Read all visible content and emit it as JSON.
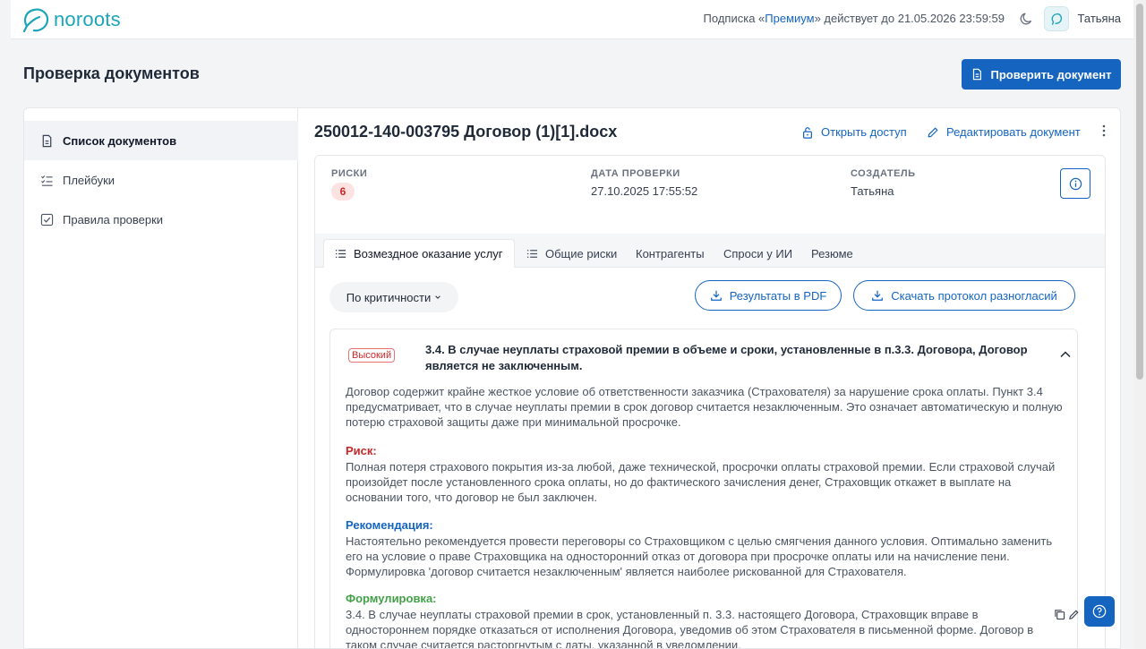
{
  "topbar": {
    "logo_text": "noroots",
    "subscription_prefix": "Подписка «",
    "subscription_plan": "Премиум",
    "subscription_suffix": "» действует до 21.05.2026 23:59:59",
    "username": "Татьяна"
  },
  "page": {
    "title": "Проверка документов",
    "check_button_label": "Проверить документ"
  },
  "sidebar": {
    "items": [
      {
        "label": "Список документов",
        "icon": "document-icon",
        "active": true
      },
      {
        "label": "Плейбуки",
        "icon": "checklist-icon",
        "active": false
      },
      {
        "label": "Правила проверки",
        "icon": "checkbox-icon",
        "active": false
      }
    ]
  },
  "document": {
    "title": "250012-140-003795 Договор (1)[1].docx",
    "open_access_label": "Открыть доступ",
    "edit_label": "Редактировать документ"
  },
  "info": {
    "risks_label": "РИСКИ",
    "risks_count": "6",
    "date_label": "ДАТА ПРОВЕРКИ",
    "date_value": "27.10.2025 17:55:52",
    "creator_label": "СОЗДАТЕЛЬ",
    "creator_value": "Татьяна"
  },
  "tabs": [
    {
      "label": "Возмездное оказание услуг",
      "active": true
    },
    {
      "label": "Общие риски",
      "active": false
    },
    {
      "label": "Контрагенты",
      "active": false
    },
    {
      "label": "Спроси у ИИ",
      "active": false
    },
    {
      "label": "Резюме",
      "active": false
    }
  ],
  "toolbar": {
    "sort_label": "По критичности",
    "pdf_label": "Результаты в PDF",
    "protocol_label": "Скачать протокол разногласий"
  },
  "risk": {
    "severity": "Высокий",
    "title": "3.4. В случае неуплаты страховой премии в объеме и сроки, установленные в п.3.3. Договора, Договор является не заключенным.",
    "description": "Договор содержит крайне жесткое условие об ответственности заказчика (Страхователя) за нарушение срока оплаты. Пункт 3.4 предусматривает, что в случае неуплаты премии в срок договор считается незаключенным. Это означает автоматическую и полную потерю страховой защиты даже при минимальной просрочке.",
    "risk_heading": "Риск:",
    "risk_text": "Полная потеря страхового покрытия из-за любой, даже технической, просрочки оплаты страховой премии. Если страховой случай произойдет после установленного срока оплаты, но до фактического зачисления денег, Страховщик откажет в выплате на основании того, что договор не был заключен.",
    "recommendation_heading": "Рекомендация:",
    "recommendation_text": "Настоятельно рекомендуется провести переговоры со Страховщиком с целью смягчения данного условия. Оптимально заменить его на условие о праве Страховщика на односторонний отказ от договора при просрочке оплаты или на начисление пени. Формулировка 'договор считается незаключенным' является наиболее рискованной для Страхователя.",
    "wording_heading": "Формулировка:",
    "wording_text": "3.4. В случае неуплаты страховой премии в срок, установленный п. 3.3. настоящего Договора, Страховщик вправе в одностороннем порядке отказаться от исполнения Договора, уведомив об этом Страхователя в письменной форме. Договор в таком случае считается расторгнутым с даты, указанной в уведомлении."
  },
  "colors": {
    "accent": "#1565c0",
    "logo": "#1aa5b8",
    "risk_red": "#c62828",
    "recommendation_blue": "#1565c0",
    "wording_green": "#43a047"
  }
}
